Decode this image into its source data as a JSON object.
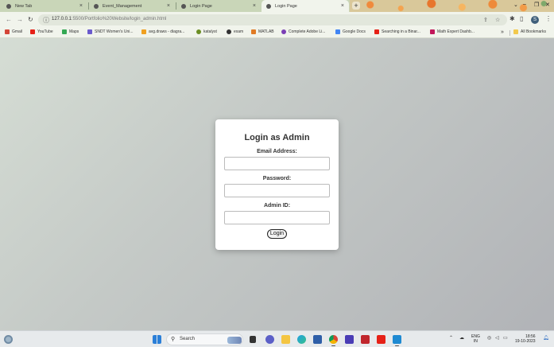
{
  "browser": {
    "tabs": [
      {
        "title": "New Tab",
        "active": false
      },
      {
        "title": "Event_Management",
        "active": false
      },
      {
        "title": "Login Page",
        "active": false
      },
      {
        "title": "Login Page",
        "active": true
      }
    ],
    "new_tab_label": "+",
    "address": {
      "host": "127.0.0.1",
      "rest": ":5500/Portfolio%20Website/login_admin.html"
    },
    "profile_initial": "S",
    "bookmarks": [
      {
        "label": "Gmail",
        "color": "#d44638"
      },
      {
        "label": "YouTube",
        "color": "#e62117"
      },
      {
        "label": "Maps",
        "color": "#34a853"
      },
      {
        "label": "SNDT Women's Uni...",
        "color": "#6a5acd"
      },
      {
        "label": "avg.draws - diagra...",
        "color": "#f0a020"
      },
      {
        "label": "katalyst",
        "color": "#6b8e23"
      },
      {
        "label": "exam",
        "color": "#333333"
      },
      {
        "label": "MATLAB",
        "color": "#e07b24"
      },
      {
        "label": "Complete Adobe Li...",
        "color": "#7b3fb5"
      },
      {
        "label": "Google Docs",
        "color": "#4285f4"
      },
      {
        "label": "Searching in a Binar...",
        "color": "#e62117"
      },
      {
        "label": "Math Expert Dashb...",
        "color": "#c2185b"
      }
    ],
    "all_bookmarks": "All Bookmarks"
  },
  "login": {
    "title": "Login as Admin",
    "email_label": "Email Address:",
    "password_label": "Password:",
    "admin_id_label": "Admin ID:",
    "button_label": "Login"
  },
  "taskbar": {
    "search_label": "Search",
    "lang_top": "ENG",
    "lang_bottom": "IN",
    "time": "18:56",
    "date": "19-10-2023"
  },
  "colors": {
    "page_bg_light": "#d5ddd4",
    "page_bg_dark": "#b1b3b7",
    "card_bg": "#ffffff",
    "tab_active": "#f1f4ec"
  }
}
